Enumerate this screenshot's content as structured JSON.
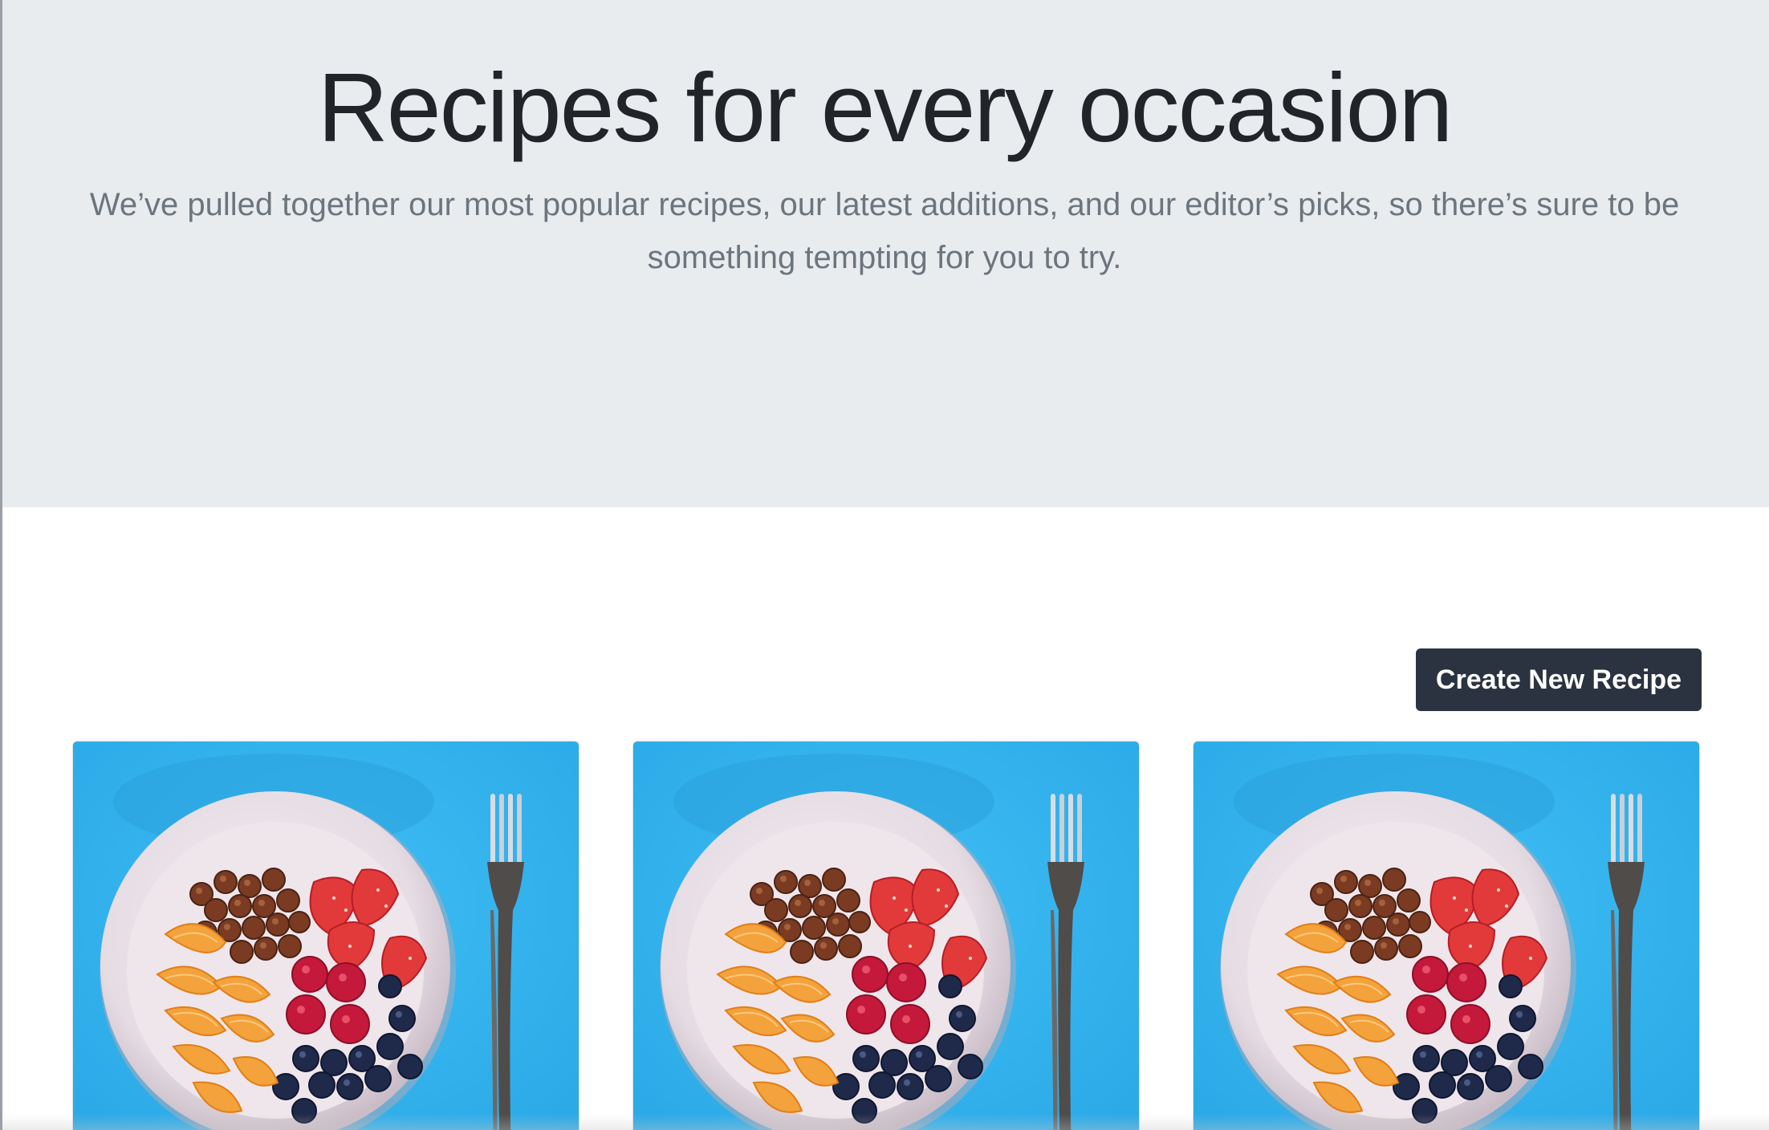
{
  "hero": {
    "title": "Recipes for every occasion",
    "lead": "We’ve pulled together our most popular recipes, our latest additions, and our editor’s picks, so there’s sure to be something tempting for you to try."
  },
  "actions": {
    "create_label": "Create New Recipe"
  },
  "recipes": [
    {
      "image": "fruit-bowl-photo"
    },
    {
      "image": "fruit-bowl-photo"
    },
    {
      "image": "fruit-bowl-photo"
    }
  ],
  "colors": {
    "hero_bg": "#e9ecef",
    "title_text": "#212529",
    "lead_text": "#6c757d",
    "button_bg": "#2b3340",
    "card_bg": "#33b3ee"
  }
}
